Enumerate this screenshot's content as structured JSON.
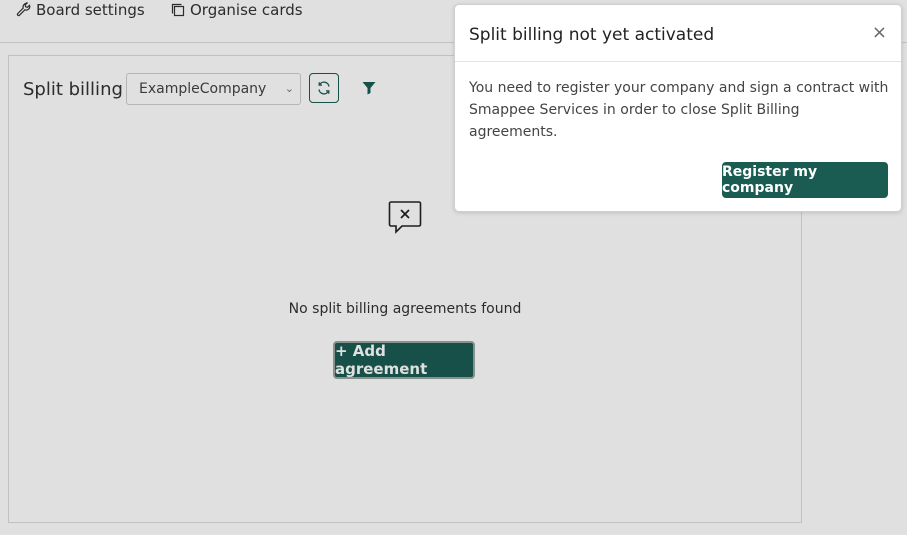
{
  "toolbar": {
    "board_settings": {
      "label": "Board settings",
      "icon": "wrench-icon"
    },
    "organise_cards": {
      "label": "Organise cards",
      "icon": "copy-icon"
    }
  },
  "card": {
    "title": "Split billing",
    "company_select": {
      "value": "ExampleCompany"
    },
    "empty_state": {
      "message": "No split billing agreements found",
      "icon": "no-messages-icon"
    },
    "add_button": "+ Add agreement"
  },
  "modal": {
    "title": "Split billing not yet activated",
    "close": "×",
    "body": "You need to register your company and sign a contract with Smappee Services in order to close Split Billing agreements.",
    "primary_button": "Register my company"
  },
  "colors": {
    "accent": "#1a5c52",
    "overlay": "rgba(0,0,0,0.12)"
  }
}
